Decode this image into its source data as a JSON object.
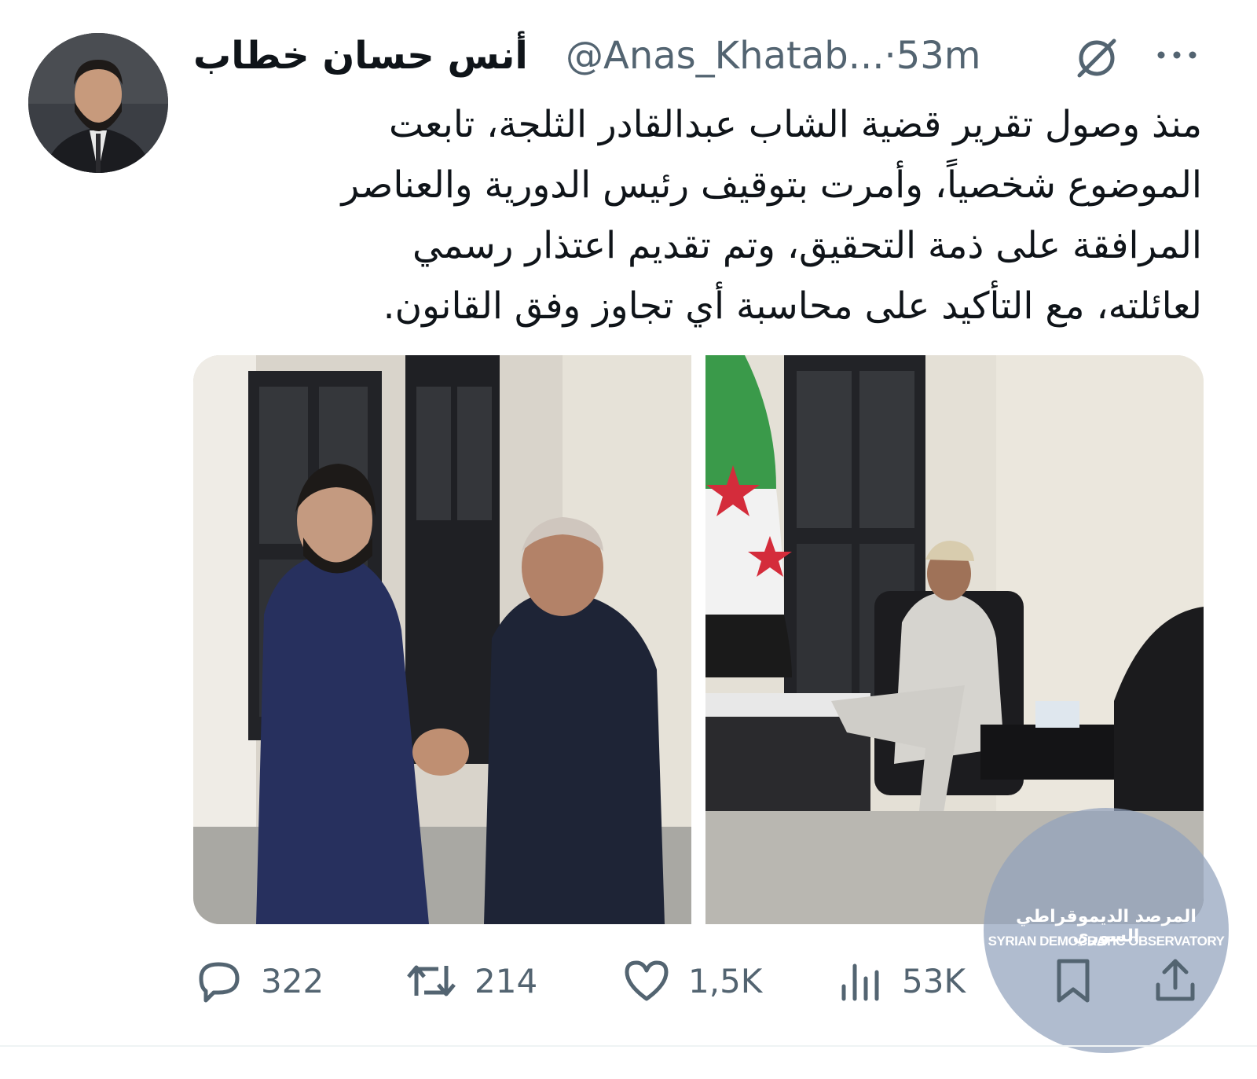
{
  "author": {
    "display_name": "أنس حسان خطاب",
    "handle": "@Anas_Khatab...",
    "time": "·53m",
    "avatar_icon": "profile-photo"
  },
  "tweet": {
    "text": "منذ وصول تقرير قضية الشاب عبدالقادر الثلجة، تابعت\nالموضوع شخصياً، وأمرت بتوقيف رئيس الدورية والعناصر\nالمرافقة على ذمة التحقيق، وتم تقديم اعتذار رسمي\nلعائلته، مع التأكيد على محاسبة أي تجاوز وفق القانون."
  },
  "media": {
    "photos": [
      {
        "icon": "photo-handshake"
      },
      {
        "icon": "photo-office-meeting"
      }
    ]
  },
  "actions": {
    "reply": {
      "icon": "reply-icon",
      "count": "322"
    },
    "repost": {
      "icon": "repost-icon",
      "count": "214"
    },
    "like": {
      "icon": "heart-icon",
      "count": "1,5K"
    },
    "views": {
      "icon": "views-icon",
      "count": "53K"
    },
    "bookmark": {
      "icon": "bookmark-icon"
    },
    "share": {
      "icon": "share-icon"
    }
  },
  "watermark": {
    "arabic": "المرصد الديموقراطي السوري",
    "english": "SYRIAN DEMOCRATIC OBSERVATORY"
  },
  "colors": {
    "text": "#0f1419",
    "secondary": "#536471",
    "background": "#ffffff"
  }
}
